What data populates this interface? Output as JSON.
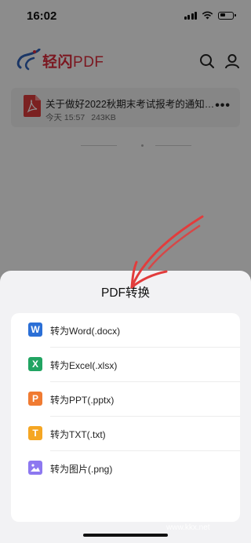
{
  "status_bar": {
    "time": "16:02"
  },
  "app": {
    "name_cn": "轻闪",
    "name_pdf": "PDF"
  },
  "file": {
    "name": "关于做好2022秋期末考试报考的通知…",
    "date": "今天 15:57",
    "size": "243KB",
    "more": "•••"
  },
  "sheet": {
    "title": "PDF转换",
    "options": [
      {
        "label": "转为Word(.docx)",
        "icon_char": "W",
        "color": "#2b6fd6"
      },
      {
        "label": "转为Excel(.xlsx)",
        "icon_char": "X",
        "color": "#21a462"
      },
      {
        "label": "转为PPT(.pptx)",
        "icon_char": "P",
        "color": "#f07b32"
      },
      {
        "label": "转为TXT(.txt)",
        "icon_char": "T",
        "color": "#f5a623"
      },
      {
        "label": "转为图片(.png)",
        "icon_char": "",
        "color": "#8d78f0"
      }
    ]
  },
  "watermark": {
    "text": "www.kkx.net"
  }
}
